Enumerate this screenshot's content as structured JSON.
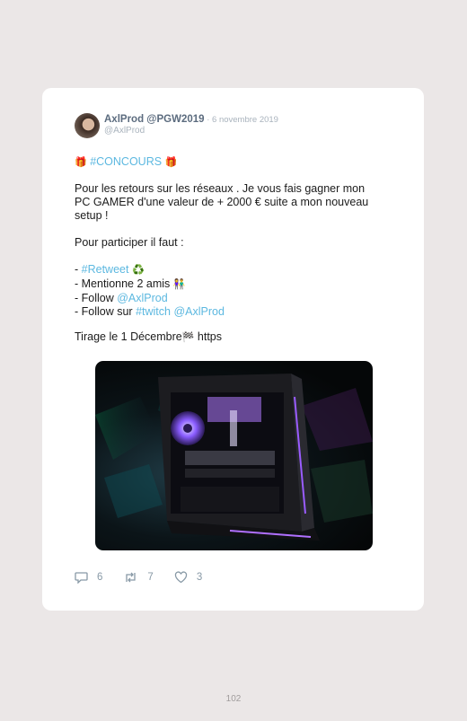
{
  "tweet": {
    "author_name": "AxlProd @PGW2019",
    "separator": " · ",
    "date": "6 novembre 2019",
    "handle": "@AxlProd",
    "line_concours": "#CONCOURS",
    "para1_l1": "Pour les retours sur les réseaux . Je vous fais gagner mon",
    "para1_l2": "PC GAMER d'une valeur de + 2000 € suite a mon nouveau",
    "para1_l3": "setup !",
    "para2": "Pour participer il faut :",
    "bullet1_prefix": "- ",
    "bullet1_link": "#Retweet",
    "bullet2": "- Mentionne 2 amis",
    "bullet3_prefix": "- Follow ",
    "bullet3_link": "@AxlProd",
    "bullet4_prefix": "- Follow sur ",
    "bullet4_link1": "#twitch",
    "bullet4_link2": "@AxlProd",
    "tirage_prefix": "Tirage le 1 Décembre",
    "tirage_suffix": " https",
    "replies": "6",
    "retweets": "7",
    "likes": "3"
  },
  "page_number": "102",
  "icons": [
    "gift-icon",
    "recycle-icon",
    "friends-icon",
    "checkered-flag-icon",
    "reply-icon",
    "retweet-icon",
    "heart-icon"
  ],
  "colors": {
    "link": "#5cb8e0",
    "name": "#5b6b7e",
    "muted": "#a9b3bd",
    "background": "#ebe7e7"
  }
}
